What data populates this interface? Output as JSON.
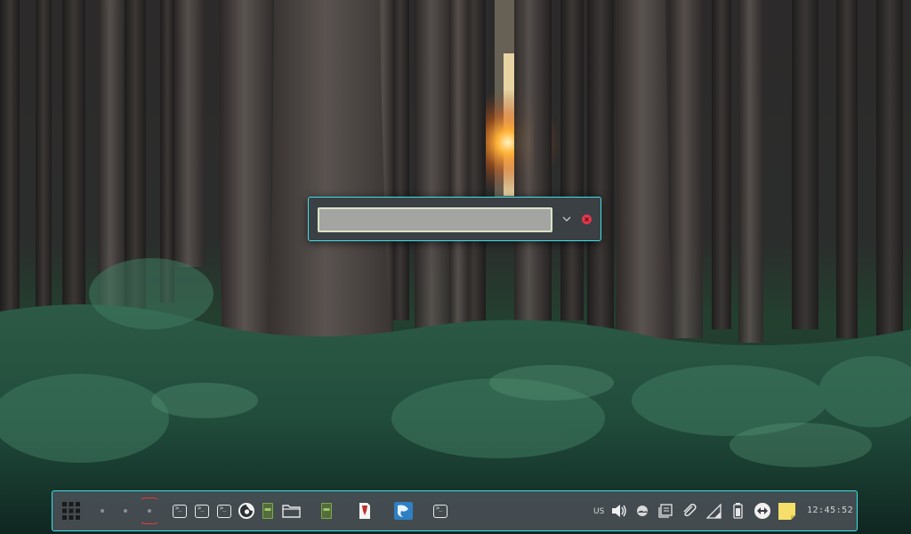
{
  "run_dialog": {
    "input_value": "",
    "expand_icon": "chevron-down-icon",
    "close_icon": "close-icon",
    "close_color": "#e2364c",
    "border_color": "#3ee0ea"
  },
  "taskbar": {
    "launcher_icon": "app-grid-icon",
    "workspaces": [
      {
        "active": false
      },
      {
        "active": false
      },
      {
        "active": true
      }
    ],
    "apps": [
      {
        "icon": "terminal-icon"
      },
      {
        "icon": "terminal-icon"
      },
      {
        "icon": "terminal-icon"
      },
      {
        "icon": "firefox-icon"
      },
      {
        "icon": "text-editor-icon"
      },
      {
        "icon": "folder-icon"
      },
      {
        "icon": "text-editor-icon"
      },
      {
        "icon": "libreoffice-icon"
      },
      {
        "icon": "libreoffice-draw-icon"
      },
      {
        "icon": "terminal-icon"
      }
    ],
    "tray": {
      "keyboard_layout": "US",
      "icons": [
        "volume-icon",
        "weather-icon",
        "clipboard-icon",
        "attachment-icon",
        "signal-icon",
        "battery-icon",
        "network-icon",
        "sticky-note-icon"
      ]
    },
    "clock": "12:45:52",
    "accent_color": "#3ee0ea",
    "active_workspace_color": "#e23b3b"
  }
}
